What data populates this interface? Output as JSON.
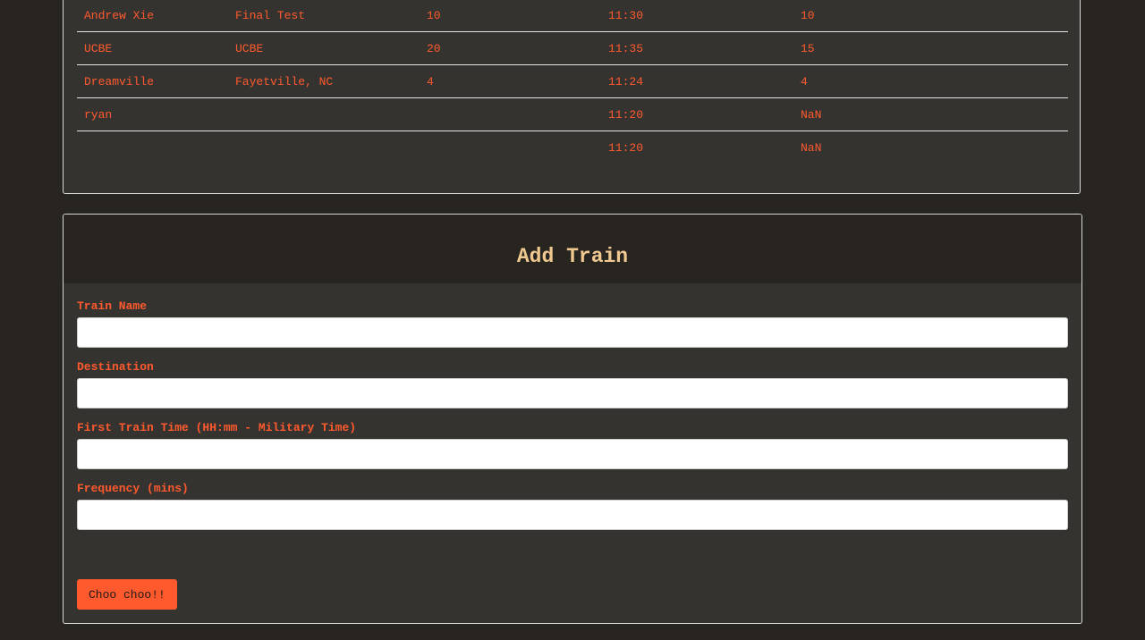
{
  "schedule": {
    "rows": [
      {
        "name": "Andrew Xie",
        "destination": "Final Test",
        "frequency": "10",
        "next_arrival": "11:30",
        "minutes_away": "10"
      },
      {
        "name": "UCBE",
        "destination": "UCBE",
        "frequency": "20",
        "next_arrival": "11:35",
        "minutes_away": "15"
      },
      {
        "name": "Dreamville",
        "destination": "Fayetville, NC",
        "frequency": "4",
        "next_arrival": "11:24",
        "minutes_away": "4"
      },
      {
        "name": "ryan",
        "destination": "",
        "frequency": "",
        "next_arrival": "11:20",
        "minutes_away": "NaN"
      },
      {
        "name": "",
        "destination": "",
        "frequency": "",
        "next_arrival": "11:20",
        "minutes_away": "NaN"
      }
    ]
  },
  "add_train": {
    "title": "Add Train",
    "fields": {
      "train_name": {
        "label": "Train Name",
        "value": ""
      },
      "destination": {
        "label": "Destination",
        "value": ""
      },
      "first_train_time": {
        "label": "First Train Time (HH:mm - Military Time)",
        "value": ""
      },
      "frequency": {
        "label": "Frequency (mins)",
        "value": ""
      }
    },
    "submit_label": "Choo choo!!"
  },
  "colors": {
    "page_background": "#28241f",
    "panel_background": "#353330",
    "accent_text": "#ff5a2e",
    "heading_text": "#f0c991",
    "button_background": "#ff5a2e"
  }
}
